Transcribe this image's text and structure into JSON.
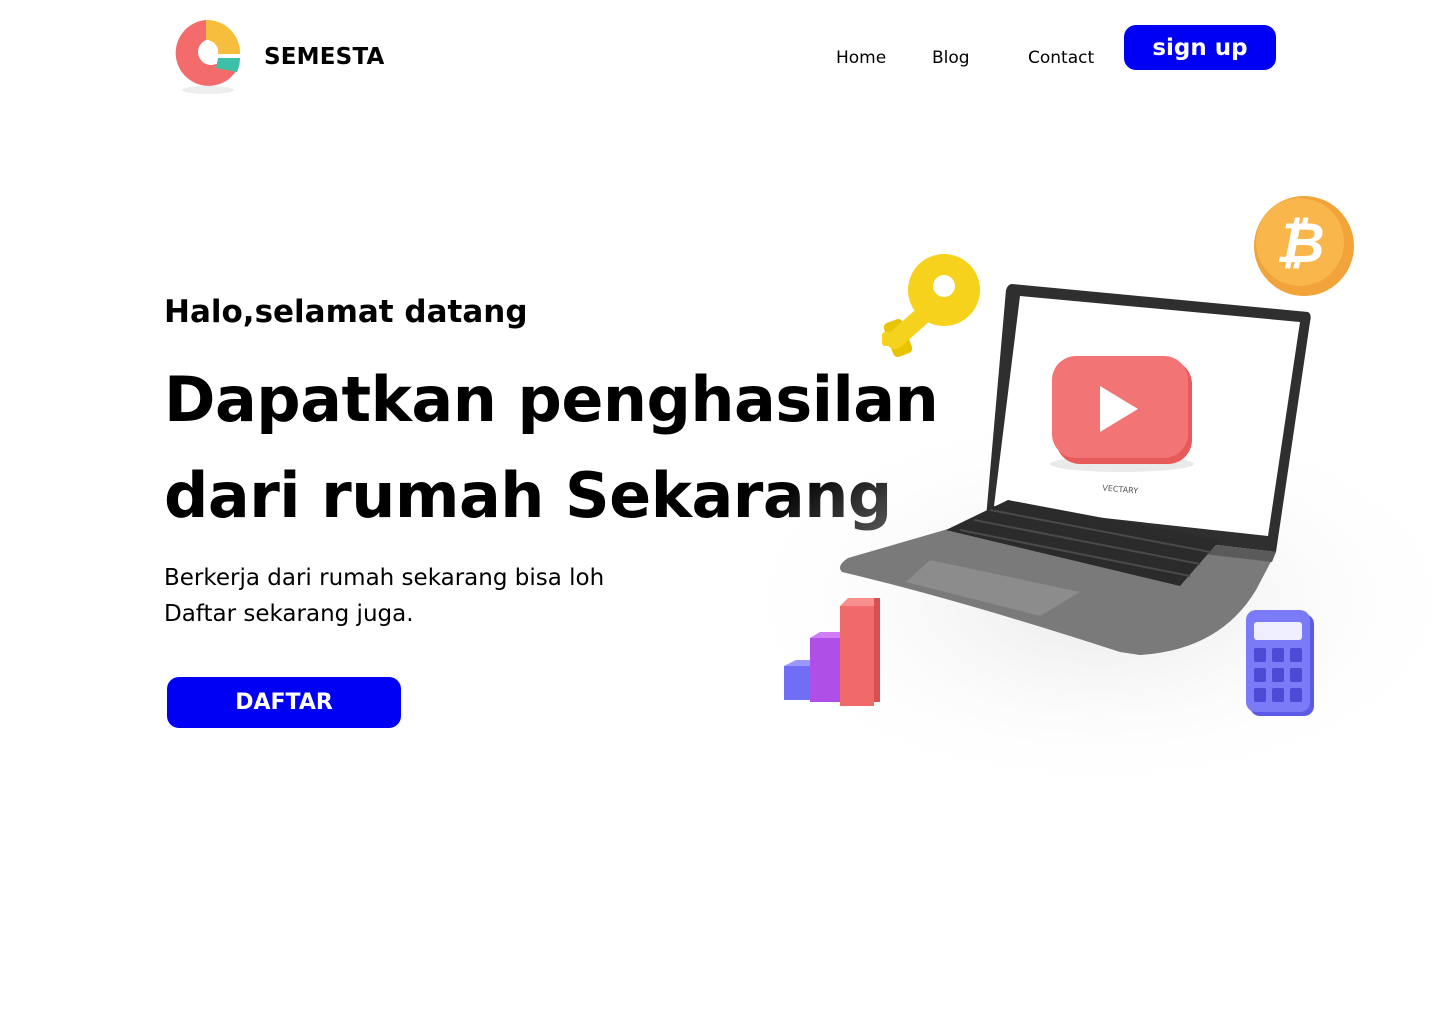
{
  "header": {
    "brand": "SEMESTA",
    "logo_icon": "donut-chart-logo",
    "nav": [
      {
        "label": "Home"
      },
      {
        "label": "Blog"
      },
      {
        "label": "Contact"
      }
    ],
    "signup_label": "sign up"
  },
  "hero": {
    "greeting": "Halo,selamat datang",
    "headline_line1": "Dapatkan penghasilan",
    "headline_line2": "dari rumah Sekarang",
    "subtext_line1": "Berkerja dari rumah sekarang bisa loh",
    "subtext_line2": "Daftar sekarang juga.",
    "cta_label": "DAFTAR"
  },
  "illustration": {
    "laptop_screen_label": "VECTARY",
    "objects": [
      "key-icon",
      "bitcoin-coin-icon",
      "laptop-icon",
      "play-button-icon",
      "bar-chart-icon",
      "calculator-icon"
    ]
  },
  "colors": {
    "accent": "#0000f5",
    "logo_red": "#f46b6b",
    "logo_yellow": "#f7bd3c",
    "logo_teal": "#3dbfa8"
  }
}
